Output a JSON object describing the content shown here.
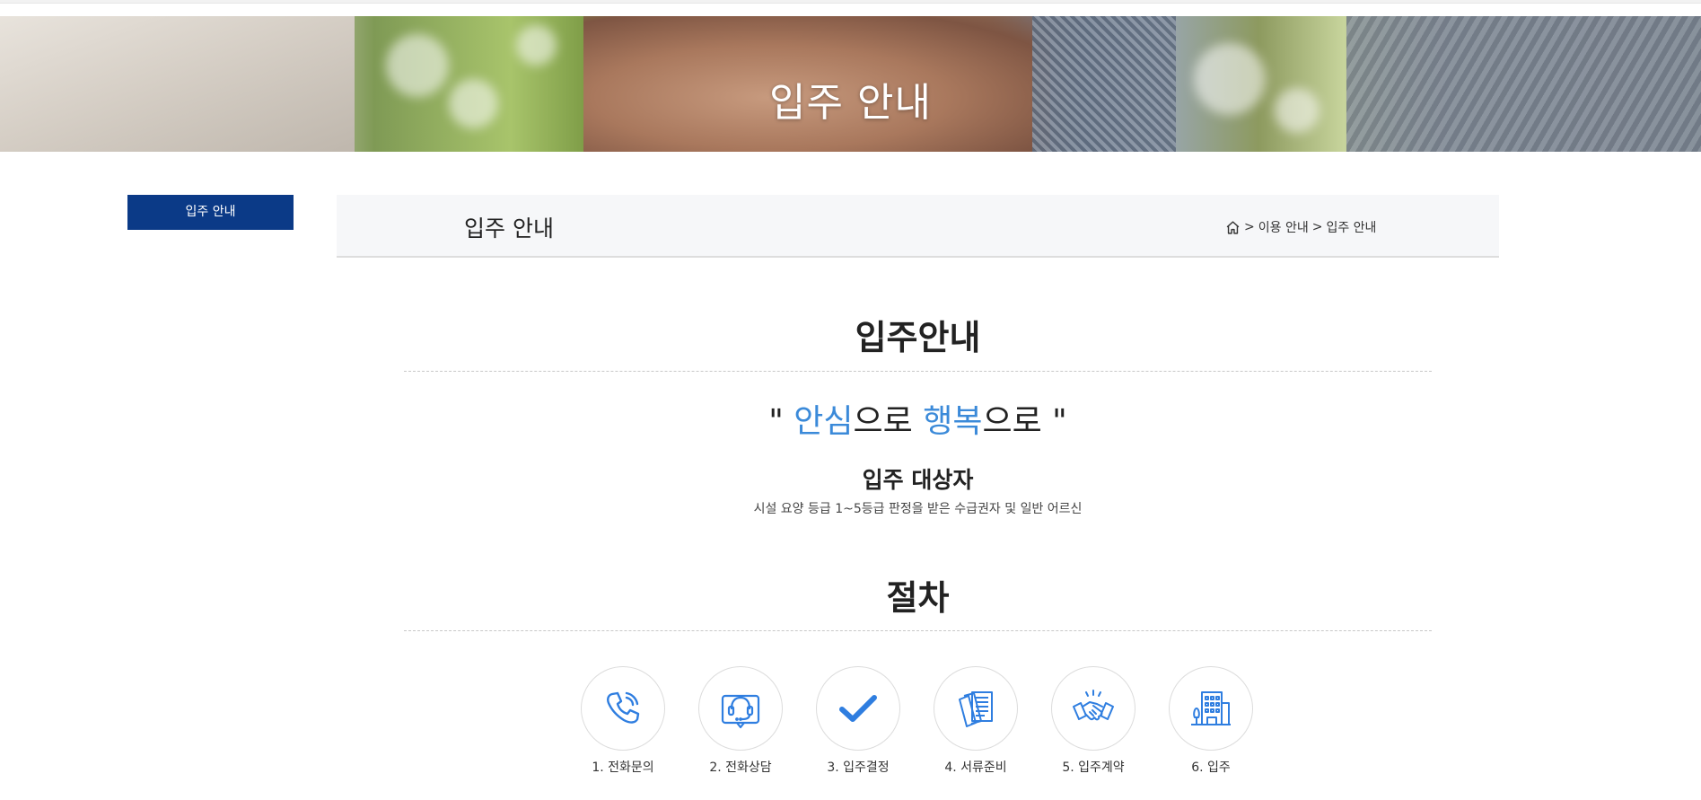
{
  "hero": {
    "title": "입주 안내"
  },
  "side_menu": {
    "items": [
      {
        "label": "입주 안내",
        "active": true
      }
    ]
  },
  "header": {
    "page_title": "입주 안내",
    "breadcrumb": [
      "이용 안내",
      "입주 안내"
    ],
    "separator": ">"
  },
  "main": {
    "section_title": "입주안내",
    "slogan": {
      "open_quote": "\" ",
      "word1": "안심",
      "mid": "으로 ",
      "word2": "행복",
      "end": "으로 \""
    },
    "target_title": "입주 대상자",
    "target_desc": "시설 요양 등급 1~5등급 판정을 받은 수급권자 및 일반 어르신",
    "procedure_title": "절차",
    "steps": [
      {
        "label": "1. 전화문의",
        "icon": "phone-icon"
      },
      {
        "label": "2. 전화상담",
        "icon": "headset-icon"
      },
      {
        "label": "3. 입주결정",
        "icon": "checkmark-icon"
      },
      {
        "label": "4. 서류준비",
        "icon": "documents-icon"
      },
      {
        "label": "5. 입주계약",
        "icon": "handshake-icon"
      },
      {
        "label": "6. 입주",
        "icon": "building-icon"
      }
    ]
  },
  "colors": {
    "navy": "#0b3a87",
    "accent_blue": "#3b8ad9",
    "icon_blue": "#2f7ee0"
  }
}
